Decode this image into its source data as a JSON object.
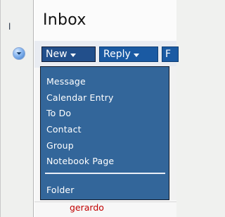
{
  "header": {
    "title": "Inbox"
  },
  "left_pane": {
    "glimpse_text": "l",
    "dropdown_icon": "chevron-down-icon"
  },
  "toolbar": {
    "new_label": "New",
    "reply_label": "Reply",
    "more_label": "F"
  },
  "new_menu": {
    "items": [
      {
        "label": "Message"
      },
      {
        "label": "Calendar Entry"
      },
      {
        "label": "To Do"
      },
      {
        "label": "Contact"
      },
      {
        "label": "Group"
      },
      {
        "label": "Notebook Page"
      },
      {
        "label": "Folder"
      }
    ]
  },
  "bottom": {
    "sender_name": "gerardo"
  },
  "colors": {
    "menu_bg": "#33669a",
    "toolbar_button": "#1a5aa3",
    "sender_name": "#c00000"
  }
}
